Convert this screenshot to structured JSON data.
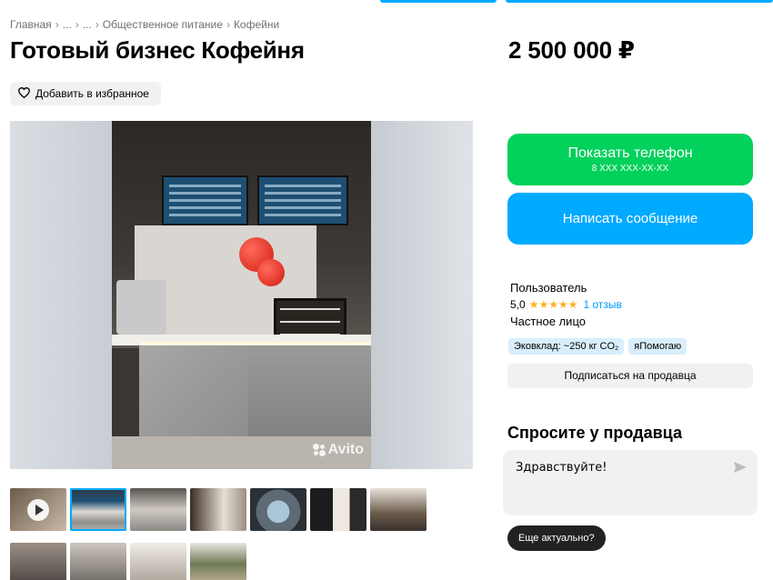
{
  "breadcrumb": {
    "items": [
      "Главная",
      "...",
      "...",
      "Общественное питание",
      "Кофейни"
    ],
    "separator": "›"
  },
  "listing": {
    "title": "Готовый бизнес Кофейня",
    "price": "2 500 000 ₽",
    "favorite_label": "Добавить в избранное",
    "photo_watermark": "Avito"
  },
  "actions": {
    "phone_label": "Показать телефон",
    "phone_masked": "8 XXX XXX-XX-XX",
    "message_label": "Написать сообщение"
  },
  "seller": {
    "name": "Пользователь",
    "rating": "5,0",
    "stars": "★★★★★",
    "reviews": "1 отзыв",
    "type": "Частное лицо",
    "badges": [
      "Эковклад: ~250 кг CO₂",
      "яПомогаю"
    ],
    "subscribe_label": "Подписаться на продавца"
  },
  "ask": {
    "title": "Спросите у продавца",
    "message": "Здравствуйте!",
    "quick_reply": "Еще актуально?"
  },
  "thumbnails": {
    "count": 11,
    "active_index": 1,
    "video_index": 0
  },
  "colors": {
    "accent_blue": "#00aaff",
    "phone_green": "#02d15c",
    "badge_blue": "#d9eefc",
    "star_gold": "#ffb021",
    "link_blue": "#0099ff"
  },
  "icons": {
    "favorite": "heart-outline-icon",
    "video": "play-icon",
    "send": "send-arrow-icon",
    "watermark": "avito-logo-icon"
  }
}
